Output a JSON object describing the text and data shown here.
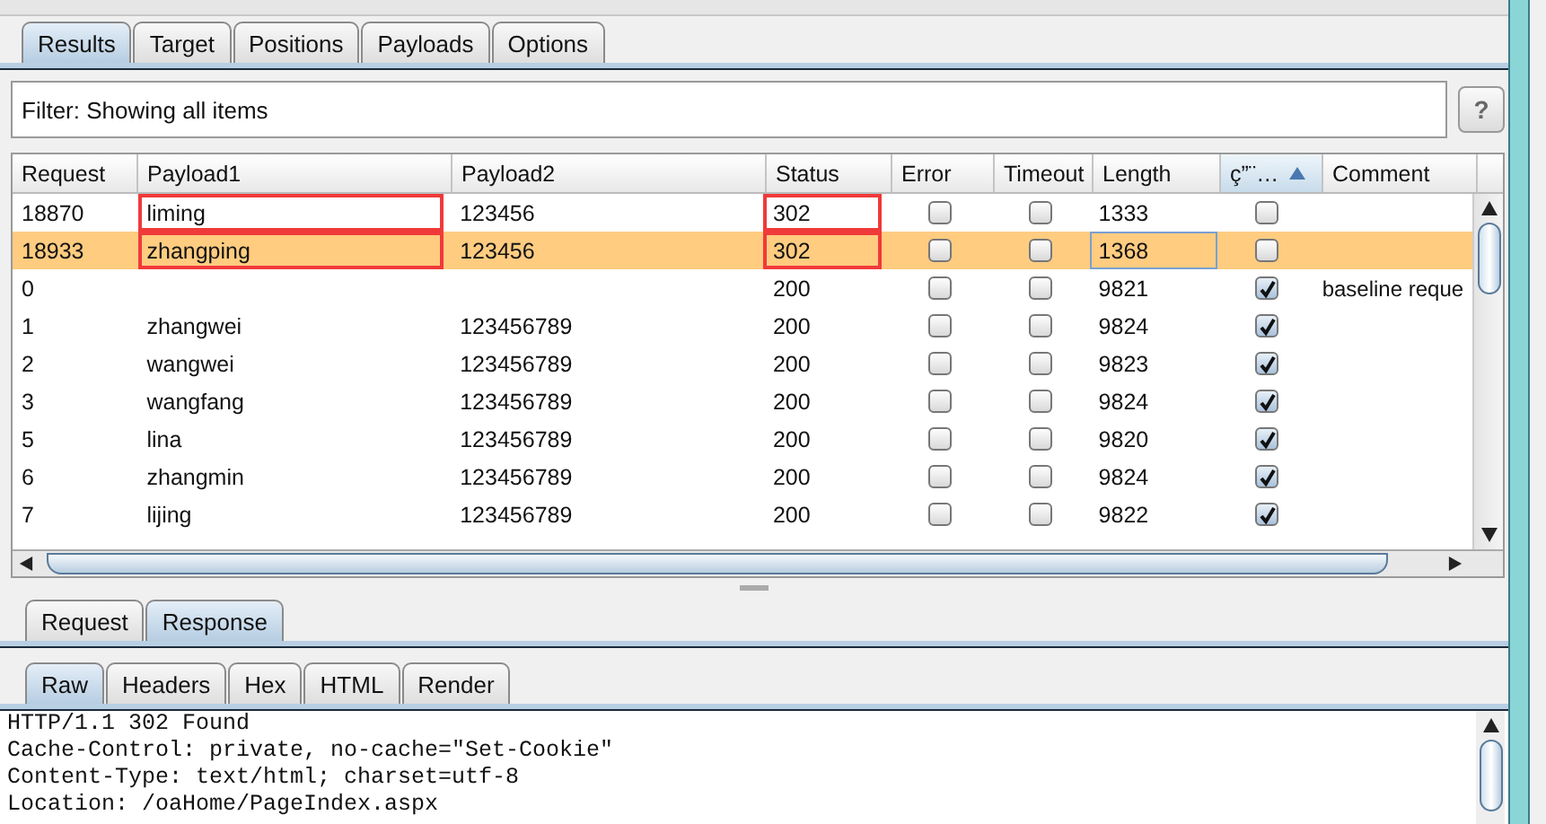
{
  "tabs": [
    {
      "label": "Results",
      "selected": true
    },
    {
      "label": "Target",
      "selected": false
    },
    {
      "label": "Positions",
      "selected": false
    },
    {
      "label": "Payloads",
      "selected": false
    },
    {
      "label": "Options",
      "selected": false
    }
  ],
  "filter": {
    "text": "Filter: Showing all items",
    "help": "?"
  },
  "table": {
    "columns": [
      {
        "label": "Request",
        "sorted": false
      },
      {
        "label": "Payload1",
        "sorted": false
      },
      {
        "label": "Payload2",
        "sorted": false
      },
      {
        "label": "Status",
        "sorted": false
      },
      {
        "label": "Error",
        "sorted": false
      },
      {
        "label": "Timeout",
        "sorted": false
      },
      {
        "label": "Length",
        "sorted": false
      },
      {
        "label": "ç”¨…",
        "sorted": true
      },
      {
        "label": "Comment",
        "sorted": false
      }
    ],
    "rows": [
      {
        "request": "18870",
        "payload1": "liming",
        "payload2": "123456",
        "status": "302",
        "error": false,
        "timeout": false,
        "length": "1333",
        "flag": false,
        "selected": false,
        "length_focused": false,
        "payload1_marked": true,
        "status_marked": true
      },
      {
        "request": "18933",
        "payload1": "zhangping",
        "payload2": "123456",
        "status": "302",
        "error": false,
        "timeout": false,
        "length": "1368",
        "flag": false,
        "selected": true,
        "length_focused": true,
        "payload1_marked": true,
        "status_marked": true
      },
      {
        "request": "0",
        "status": "200",
        "error": false,
        "timeout": false,
        "length": "9821",
        "flag": true,
        "comment": "baseline reque",
        "selected": false,
        "length_focused": false,
        "payload1_marked": false,
        "status_marked": false
      },
      {
        "request": "1",
        "payload1": "zhangwei",
        "payload2": "123456789",
        "status": "200",
        "error": false,
        "timeout": false,
        "length": "9824",
        "flag": true,
        "selected": false,
        "length_focused": false,
        "payload1_marked": false,
        "status_marked": false
      },
      {
        "request": "2",
        "payload1": "wangwei",
        "payload2": "123456789",
        "status": "200",
        "error": false,
        "timeout": false,
        "length": "9823",
        "flag": true,
        "selected": false,
        "length_focused": false,
        "payload1_marked": false,
        "status_marked": false
      },
      {
        "request": "3",
        "payload1": "wangfang",
        "payload2": "123456789",
        "status": "200",
        "error": false,
        "timeout": false,
        "length": "9824",
        "flag": true,
        "selected": false,
        "length_focused": false,
        "payload1_marked": false,
        "status_marked": false
      },
      {
        "request": "5",
        "payload1": "lina",
        "payload2": "123456789",
        "status": "200",
        "error": false,
        "timeout": false,
        "length": "9820",
        "flag": true,
        "selected": false,
        "length_focused": false,
        "payload1_marked": false,
        "status_marked": false
      },
      {
        "request": "6",
        "payload1": "zhangmin",
        "payload2": "123456789",
        "status": "200",
        "error": false,
        "timeout": false,
        "length": "9824",
        "flag": true,
        "selected": false,
        "length_focused": false,
        "payload1_marked": false,
        "status_marked": false
      },
      {
        "request": "7",
        "payload1": "lijing",
        "payload2": "123456789",
        "status": "200",
        "error": false,
        "timeout": false,
        "length": "9822",
        "flag": true,
        "selected": false,
        "length_focused": false,
        "payload1_marked": false,
        "status_marked": false
      }
    ]
  },
  "message_tabs": [
    {
      "label": "Request",
      "selected": false
    },
    {
      "label": "Response",
      "selected": true
    }
  ],
  "view_tabs": [
    {
      "label": "Raw",
      "selected": true
    },
    {
      "label": "Headers",
      "selected": false
    },
    {
      "label": "Hex",
      "selected": false
    },
    {
      "label": "HTML",
      "selected": false
    },
    {
      "label": "Render",
      "selected": false
    }
  ],
  "response_lines": [
    "HTTP/1.1 302 Found",
    "Cache-Control: private, no-cache=\"Set-Cookie\"",
    "Content-Type: text/html; charset=utf-8",
    "Location: /oaHome/PageIndex.aspx"
  ]
}
